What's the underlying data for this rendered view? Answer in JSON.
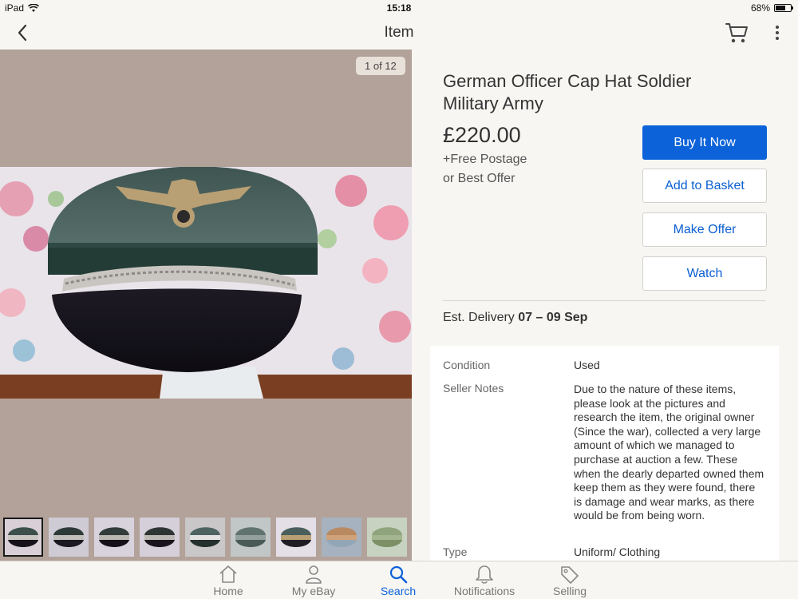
{
  "status_bar": {
    "device": "iPad",
    "time": "15:18",
    "battery": "68%",
    "battery_fraction": 0.68
  },
  "nav": {
    "title": "Item"
  },
  "photos": {
    "counter": "1 of 12"
  },
  "item": {
    "title": "German Officer Cap Hat Soldier Military Army",
    "price": "£220.00",
    "postage": "+Free Postage",
    "best_offer": "or Best Offer"
  },
  "actions": {
    "buy_now": "Buy It Now",
    "add_basket": "Add to Basket",
    "make_offer": "Make Offer",
    "watch": "Watch"
  },
  "delivery": {
    "label": "Est. Delivery",
    "dates": "07 – 09 Sep"
  },
  "specifics": {
    "condition_label": "Condition",
    "condition_value": "Used",
    "notes_label": "Seller Notes",
    "notes_value": "Due to the nature of these items, please look at the pictures and research the item, the original owner (Since the war), collected a very large amount of which we managed to purchase at auction a few. These when the dearly departed owned them keep them as they were found, there is damage and wear marks, as there would be from being worn.",
    "type_label": "Type",
    "type_value": "Uniform/ Clothing"
  },
  "tabs": [
    {
      "label": "Home",
      "icon": "home-icon"
    },
    {
      "label": "My eBay",
      "icon": "person-icon"
    },
    {
      "label": "Search",
      "icon": "search-icon"
    },
    {
      "label": "Notifications",
      "icon": "bell-icon"
    },
    {
      "label": "Selling",
      "icon": "tag-icon"
    }
  ],
  "colors": {
    "accent": "#0b62d9",
    "photo_background": "#b3a299",
    "page_background": "#f7f6f3"
  }
}
